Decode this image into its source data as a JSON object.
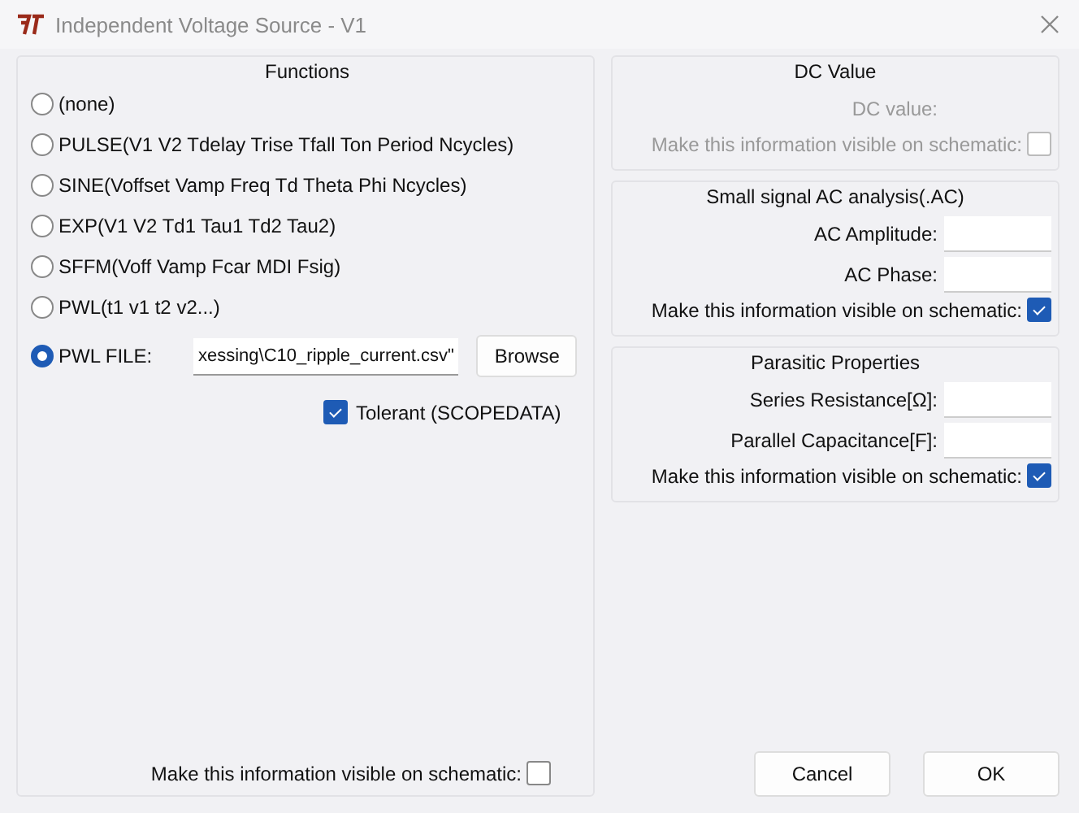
{
  "window": {
    "title": "Independent Voltage Source - V1"
  },
  "functions": {
    "title": "Functions",
    "options": [
      {
        "label": "(none)",
        "selected": false
      },
      {
        "label": "PULSE(V1 V2 Tdelay Trise Tfall Ton Period Ncycles)",
        "selected": false
      },
      {
        "label": "SINE(Voffset Vamp Freq Td Theta Phi Ncycles)",
        "selected": false
      },
      {
        "label": "EXP(V1 V2 Td1 Tau1 Td2 Tau2)",
        "selected": false
      },
      {
        "label": "SFFM(Voff Vamp Fcar MDI Fsig)",
        "selected": false
      },
      {
        "label": "PWL(t1 v1 t2 v2...)",
        "selected": false
      },
      {
        "label": "PWL FILE:",
        "selected": true
      }
    ],
    "pwl_file": {
      "value": "xessing\\C10_ripple_current.csv\""
    },
    "browse_button": "Browse",
    "tolerant": {
      "label": "Tolerant (SCOPEDATA)",
      "checked": true
    },
    "visible": {
      "label": "Make this information visible on schematic:",
      "checked": false
    }
  },
  "sections": [
    {
      "title": "DC Value",
      "disabled": true,
      "fields": [
        {
          "label": "DC value:"
        }
      ],
      "visible": {
        "label": "Make this information visible on schematic:",
        "checked": false
      }
    },
    {
      "title": "Small signal AC analysis(.AC)",
      "disabled": false,
      "fields": [
        {
          "label": "AC Amplitude:"
        },
        {
          "label": "AC Phase:"
        }
      ],
      "visible": {
        "label": "Make this information visible on schematic:",
        "checked": true
      }
    },
    {
      "title": "Parasitic Properties",
      "disabled": false,
      "fields": [
        {
          "label": "Series Resistance[Ω]:"
        },
        {
          "label": "Parallel Capacitance[F]:"
        }
      ],
      "visible": {
        "label": "Make this information visible on schematic:",
        "checked": true
      }
    }
  ],
  "buttons": [
    "Cancel",
    "OK"
  ]
}
